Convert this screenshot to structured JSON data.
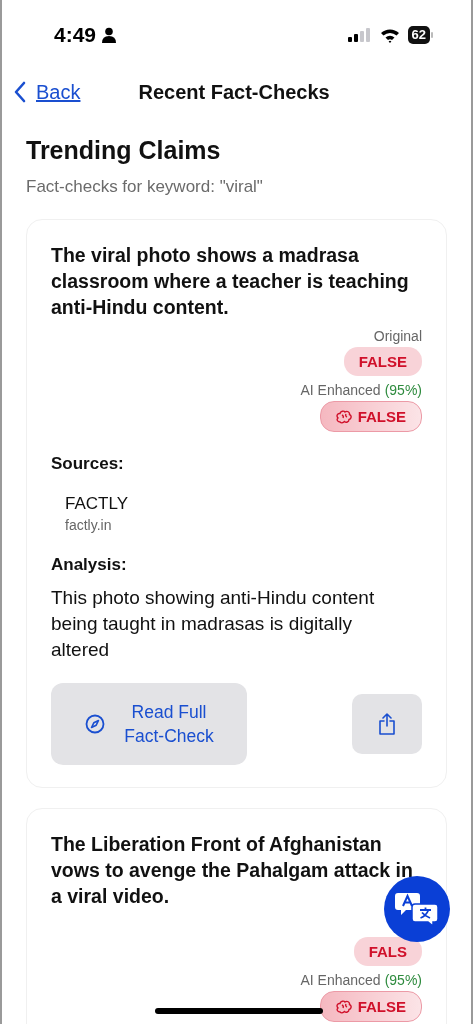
{
  "status_bar": {
    "time": "4:49",
    "battery": "62"
  },
  "nav": {
    "back": "Back",
    "title": "Recent Fact-Checks"
  },
  "header": {
    "title": "Trending Claims",
    "subtitle": "Fact-checks for keyword: \"viral\""
  },
  "claims": [
    {
      "claim": "The viral photo shows a madrasa classroom where a teacher is teaching anti-Hindu content.",
      "original_label": "Original",
      "original_verdict": "FALSE",
      "ai_label": "AI Enhanced",
      "ai_confidence": "(95%)",
      "ai_verdict": "FALSE",
      "sources_label": "Sources:",
      "sources": [
        {
          "name": "FACTLY",
          "domain": "factly.in"
        }
      ],
      "analysis_label": "Analysis:",
      "analysis": "This photo showing anti-Hindu content being taught in madrasas is digitally altered",
      "read_button": "Read Full Fact-Check"
    },
    {
      "claim": "The Liberation Front of Afghanistan vows to avenge the Pahalgam attack in a viral video.",
      "original_verdict": "FALS",
      "ai_label": "AI Enhanced",
      "ai_confidence": "(95%)",
      "ai_verdict": "FALSE"
    }
  ]
}
